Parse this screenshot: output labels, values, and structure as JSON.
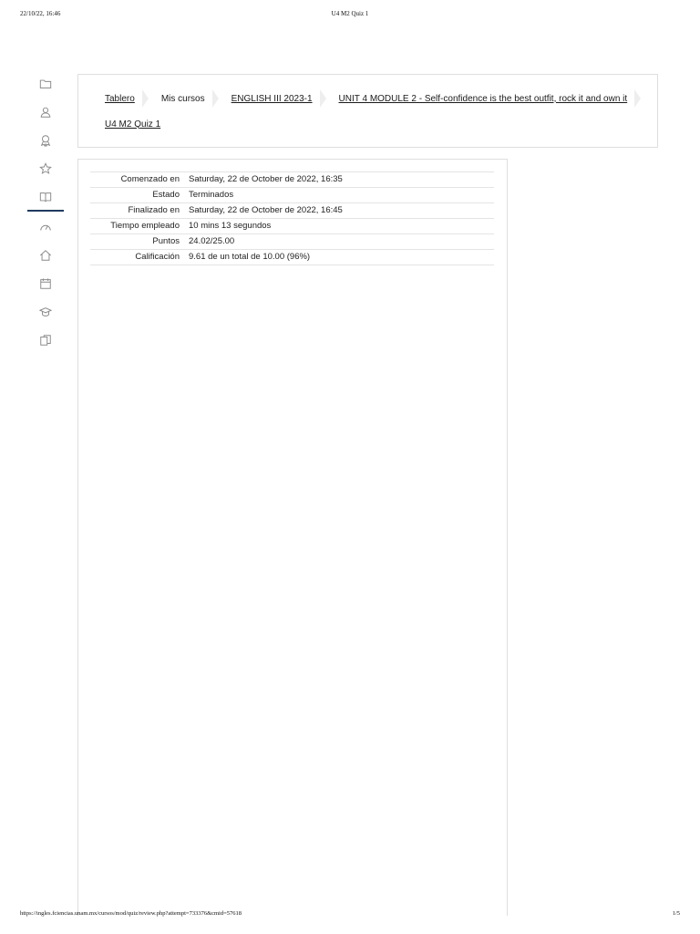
{
  "print_header": {
    "datetime": "22/10/22, 16:46",
    "doc_title": "U4 M2 Quiz 1"
  },
  "print_footer": {
    "url": "https://ingles.fciencias.unam.mx/cursos/mod/quiz/review.php?attempt=733376&cmid=57618",
    "page": "1/5"
  },
  "sidebar": {
    "icons": [
      "folder-icon",
      "user-icon",
      "award-icon",
      "star-icon",
      "book-icon",
      "dashboard-icon",
      "home-icon",
      "calendar-icon",
      "graduation-cap-icon",
      "files-icon"
    ],
    "active_color": "#1f3a5f"
  },
  "breadcrumb": {
    "items": [
      {
        "label": "Tablero"
      },
      {
        "label": "Mis cursos"
      },
      {
        "label": "ENGLISH III 2023-1"
      },
      {
        "label": "UNIT 4 MODULE 2 - Self-confidence is the best outfit, rock it and own it"
      },
      {
        "label": "U4 M2 Quiz 1"
      }
    ]
  },
  "summary": {
    "rows": [
      {
        "label": "Comenzado en",
        "value": "Saturday, 22 de October de 2022, 16:35"
      },
      {
        "label": "Estado",
        "value": "Terminados"
      },
      {
        "label": "Finalizado en",
        "value": "Saturday, 22 de October de 2022, 16:45"
      },
      {
        "label": "Tiempo empleado",
        "value": "10 mins 13 segundos"
      },
      {
        "label": "Puntos",
        "value": "24.02/25.00"
      },
      {
        "label": "Calificación",
        "value": "9.61 de un total de 10.00 (96%)"
      }
    ]
  }
}
